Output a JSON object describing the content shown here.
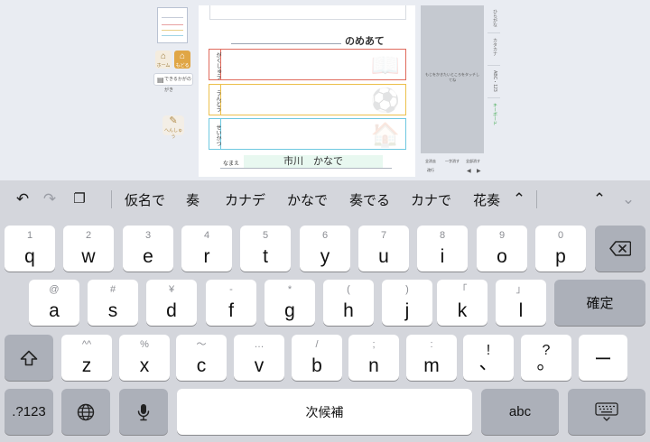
{
  "sheet": {
    "title_suffix": "のめあて",
    "goals": [
      {
        "label": "がくしゅう",
        "deco": "📖"
      },
      {
        "label": "うんどう",
        "deco": "⚽"
      },
      {
        "label": "せいかつ",
        "deco": "🏠"
      }
    ],
    "name_label": "なまえ",
    "name_value": "市川　かなで"
  },
  "left_tools": {
    "home": "ホーム",
    "return": "もどる",
    "wide": "できるかがのがき",
    "edit": "へんしゅう"
  },
  "preview": {
    "text": "もじをかきたいところをタッチしてね",
    "controls": [
      "全消去",
      "一字消す",
      "全部消す",
      "改行"
    ]
  },
  "side_tabs": [
    "ひらがな",
    "カタカナ",
    "ABC・123",
    "キーボード"
  ],
  "suggestion_bar": {
    "icons": [
      "undo-icon",
      "redo-icon",
      "paste-icon"
    ],
    "candidates": [
      "仮名で",
      "奏",
      "カナデ",
      "かなで",
      "奏でる",
      "カナで",
      "花奏"
    ]
  },
  "keyboard": {
    "row1": [
      {
        "main": "q",
        "sub": "1"
      },
      {
        "main": "w",
        "sub": "2"
      },
      {
        "main": "e",
        "sub": "3"
      },
      {
        "main": "r",
        "sub": "4"
      },
      {
        "main": "t",
        "sub": "5"
      },
      {
        "main": "y",
        "sub": "6"
      },
      {
        "main": "u",
        "sub": "7"
      },
      {
        "main": "i",
        "sub": "8"
      },
      {
        "main": "o",
        "sub": "9"
      },
      {
        "main": "p",
        "sub": "0"
      }
    ],
    "row2": [
      {
        "main": "a",
        "sub": "@"
      },
      {
        "main": "s",
        "sub": "#"
      },
      {
        "main": "d",
        "sub": "¥"
      },
      {
        "main": "f",
        "sub": "-"
      },
      {
        "main": "g",
        "sub": "*"
      },
      {
        "main": "h",
        "sub": "("
      },
      {
        "main": "j",
        "sub": ")"
      },
      {
        "main": "k",
        "sub": "「"
      },
      {
        "main": "l",
        "sub": "」"
      }
    ],
    "row3": [
      {
        "main": "z",
        "sub": "^^"
      },
      {
        "main": "x",
        "sub": "%"
      },
      {
        "main": "c",
        "sub": "〜"
      },
      {
        "main": "v",
        "sub": "…"
      },
      {
        "main": "b",
        "sub": "/"
      },
      {
        "main": "n",
        "sub": ";"
      },
      {
        "main": "m",
        "sub": ":"
      },
      {
        "main": "、",
        "sub": "!"
      },
      {
        "main": "。",
        "sub": "?"
      }
    ],
    "dash_key": "ー",
    "confirm_label": "確定",
    "numbers_label": ".?123",
    "space_label": "次候補",
    "abc_label": "abc"
  }
}
